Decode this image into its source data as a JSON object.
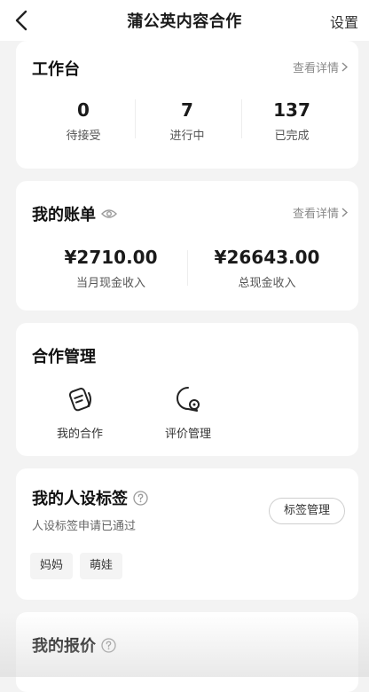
{
  "nav": {
    "title": "蒲公英内容合作",
    "settings_label": "设置"
  },
  "workbench": {
    "title": "工作台",
    "details_link": "查看详情",
    "stats": [
      {
        "value": "0",
        "label": "待接受"
      },
      {
        "value": "7",
        "label": "进行中"
      },
      {
        "value": "137",
        "label": "已完成"
      }
    ]
  },
  "bill": {
    "title": "我的账单",
    "details_link": "查看详情",
    "stats": [
      {
        "value": "¥2710.00",
        "label": "当月现金收入"
      },
      {
        "value": "¥26643.00",
        "label": "总现金收入"
      }
    ]
  },
  "cooperation": {
    "title": "合作管理",
    "tools": [
      {
        "label": "我的合作",
        "icon": "cooperation-icon"
      },
      {
        "label": "评价管理",
        "icon": "review-icon"
      }
    ]
  },
  "persona_tags": {
    "title": "我的人设标签",
    "status": "人设标签申请已通过",
    "manage_button": "标签管理",
    "tags": [
      "妈妈",
      "萌娃"
    ]
  },
  "quote": {
    "title": "我的报价"
  }
}
